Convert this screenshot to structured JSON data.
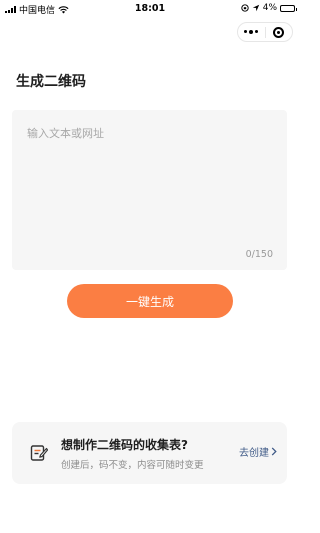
{
  "status_bar": {
    "carrier": "中国电信",
    "time": "18:01",
    "battery_percent": "4%"
  },
  "header": {
    "title": "生成二维码"
  },
  "input": {
    "placeholder": "输入文本或网址",
    "value": "",
    "counter": "0/150"
  },
  "actions": {
    "generate_label": "一键生成"
  },
  "promo": {
    "title": "想制作二维码的收集表?",
    "subtitle": "创建后，码不变，内容可随时变更",
    "link_label": "去创建",
    "link_color": "#3f5a87"
  },
  "colors": {
    "accent": "#fb7e43",
    "card_background": "#f6f6f6",
    "icon_accent": "#f07a3c"
  }
}
